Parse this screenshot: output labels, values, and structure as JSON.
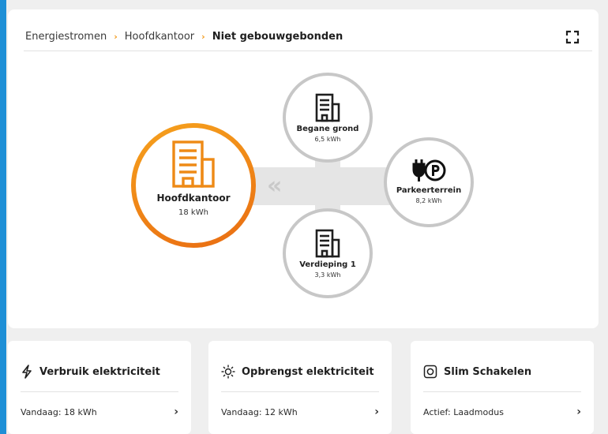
{
  "breadcrumb": {
    "items": [
      "Energiestromen",
      "Hoofdkantoor"
    ],
    "current": "Niet gebouwgebonden",
    "separator": "›"
  },
  "colors": {
    "accent": "#f29a1a",
    "node_border": "#c7c7c7",
    "frame": "#1e8fd6"
  },
  "flow": {
    "direction_glyph": "«"
  },
  "nodes": {
    "main": {
      "label": "Hoofdkantoor",
      "value": "18 kWh",
      "icon": "office-building-icon"
    },
    "top": {
      "label": "Begane grond",
      "value": "6,5 kWh",
      "icon": "building-icon"
    },
    "right": {
      "label": "Parkeerterrein",
      "value": "8,2 kWh",
      "icon": "ev-parking-icon"
    },
    "bottom": {
      "label": "Verdieping 1",
      "value": "3,3 kWh",
      "icon": "building-icon"
    }
  },
  "cards": [
    {
      "title": "Verbruik elektriciteit",
      "row": "Vandaag: 18  kWh",
      "icon": "lightning-icon"
    },
    {
      "title": "Opbrengst elektriciteit",
      "row": "Vandaag: 12 kWh",
      "icon": "sun-icon"
    },
    {
      "title": "Slim Schakelen",
      "row": "Actief: Laadmodus",
      "icon": "smart-switch-icon"
    }
  ],
  "card_chevron": "›"
}
